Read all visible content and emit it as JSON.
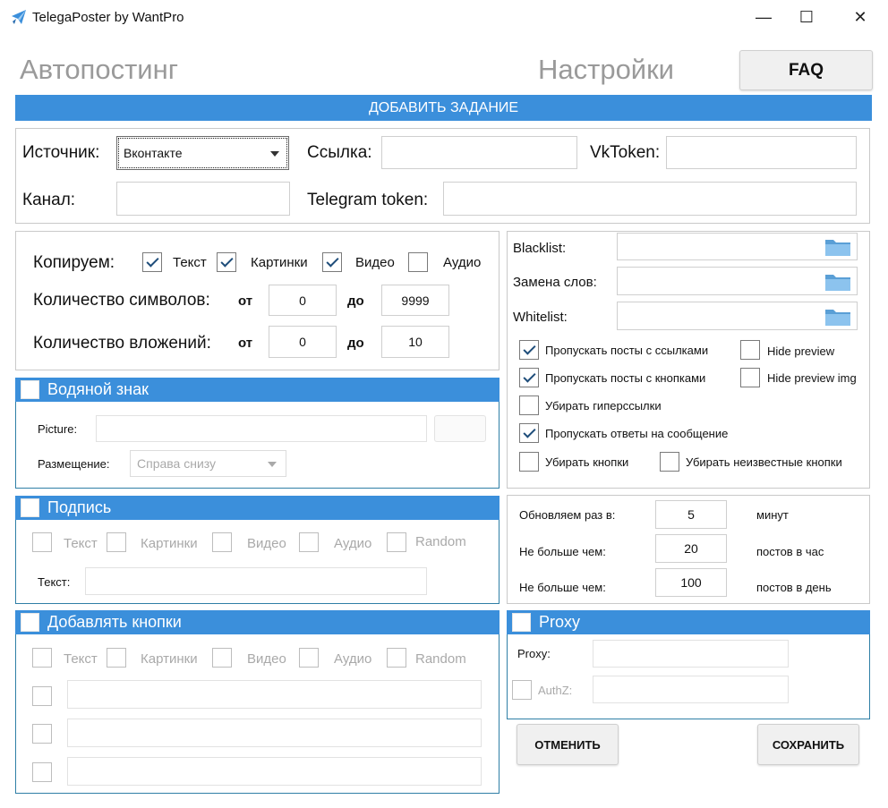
{
  "window": {
    "title": "TelegaPoster by WantPro",
    "minimize_glyph": "—",
    "maximize_glyph": "☐",
    "close_glyph": "✕",
    "app_icon": "telegram-paper-plane-icon"
  },
  "nav": {
    "autoposting": "Автопостинг",
    "settings": "Настройки",
    "faq": "FAQ"
  },
  "add_task": "ДОБАВИТЬ ЗАДАНИЕ",
  "source": {
    "source_label": "Источник:",
    "source_value": "Вконтакте",
    "link_label": "Ссылка:",
    "link_value": "",
    "vktoken_label": "VkToken:",
    "vktoken_value": "",
    "channel_label": "Канал:",
    "channel_value": "",
    "tg_token_label": "Telegram token:",
    "tg_token_value": ""
  },
  "copy": {
    "label": "Копируем:",
    "text": "Текст",
    "text_checked": true,
    "images": "Картинки",
    "images_checked": true,
    "video": "Видео",
    "video_checked": true,
    "audio": "Аудио",
    "audio_checked": false,
    "chars_label": "Количество символов:",
    "attach_label": "Количество вложений:",
    "from": "от",
    "to": "до",
    "chars_from": "0",
    "chars_to": "9999",
    "attach_from": "0",
    "attach_to": "10"
  },
  "watermark": {
    "title": "Водяной знак",
    "picture_label": "Picture:",
    "placement_label": "Размещение:",
    "placement_value": "Справа снизу"
  },
  "signature": {
    "title": "Подпись",
    "text": "Текст",
    "images": "Картинки",
    "video": "Видео",
    "audio": "Аудио",
    "random": "Random",
    "text_label": "Текст:"
  },
  "buttons_section": {
    "title": "Добавлять кнопки",
    "text": "Текст",
    "images": "Картинки",
    "video": "Видео",
    "audio": "Аудио",
    "random": "Random"
  },
  "filters": {
    "blacklist": "Blacklist:",
    "replace": "Замена слов:",
    "whitelist": "Whitelist:",
    "skip_links": "Пропускать посты с ссылками",
    "skip_links_checked": true,
    "hide_preview": "Hide preview",
    "skip_buttons": "Пропускать посты с кнопками",
    "skip_buttons_checked": true,
    "hide_preview_img": "Hide preview img",
    "remove_hyperlinks": "Убирать гиперссылки",
    "skip_replies": "Пропускать ответы на сообщение",
    "skip_replies_checked": true,
    "remove_buttons": "Убирать кнопки",
    "remove_unknown_buttons": "Убирать неизвестные кнопки"
  },
  "schedule": {
    "update_label": "Обновляем раз в:",
    "update_value": "5",
    "update_unit": "минут",
    "max_hour_label": "Не больше чем:",
    "max_hour_value": "20",
    "max_hour_unit": "постов в час",
    "max_day_label": "Не больше чем:",
    "max_day_value": "100",
    "max_day_unit": "постов в день"
  },
  "proxy": {
    "title": "Proxy",
    "proxy_label": "Proxy:",
    "authz_label": "AuthZ:"
  },
  "actions": {
    "cancel": "ОТМЕНИТЬ",
    "save": "СОХРАНИТЬ"
  }
}
